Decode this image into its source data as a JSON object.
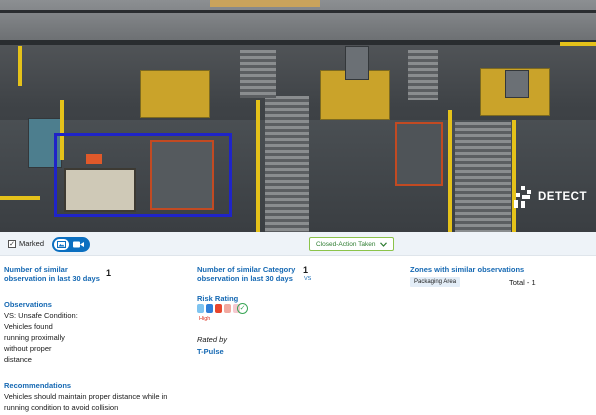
{
  "camera": {
    "logo_text": "DETECT",
    "detection_color": "#1f24c8"
  },
  "toolbar": {
    "marked_label": "Marked",
    "marked_checked": true,
    "status_label": "Closed-Action Taken",
    "status_color": "#8bc34a"
  },
  "details": {
    "similar_obs": {
      "label": "Number of similar observation in last 30 days",
      "value": "1"
    },
    "similar_category": {
      "label": "Number of similar Category observation in last 30 days",
      "value": "1",
      "tag": "VS"
    },
    "zones": {
      "label": "Zones with similar observations",
      "zone_name": "Packaging Area",
      "zone_count": "Total - 1"
    },
    "observations": {
      "label": "Observations",
      "lines": [
        "VS: Unsafe Condition:",
        "Vehicles found",
        "running proximally",
        "without proper",
        "distance"
      ]
    },
    "risk": {
      "label": "Risk Rating",
      "level": "High",
      "bar_colors": [
        "#7fc4f0",
        "#2f7fd9",
        "#e8452c",
        "#f1a9a0",
        "#f6c8cf"
      ]
    },
    "rated_by": {
      "label": "Rated by",
      "value": "T-Pulse"
    },
    "recommendations": {
      "label": "Recommendations",
      "lines": [
        "Vehicles should maintain proper distance while in",
        "running condition to avoid collision"
      ]
    }
  }
}
